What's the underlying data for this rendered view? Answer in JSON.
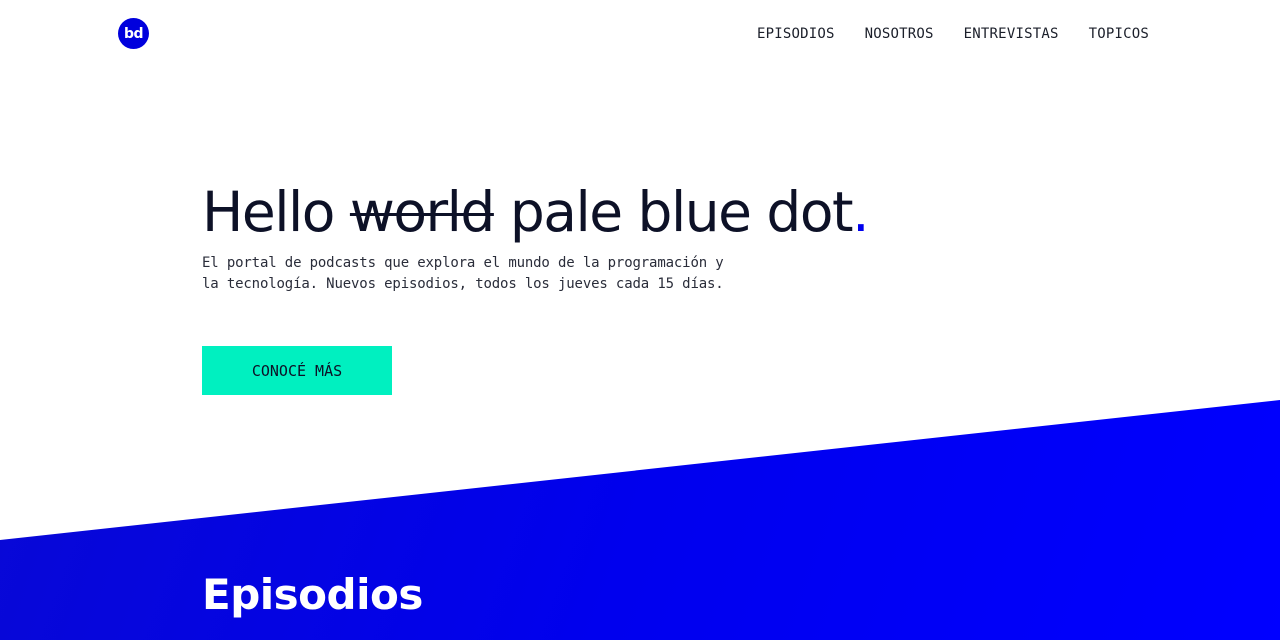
{
  "brand": {
    "logo_text": "bd"
  },
  "nav": {
    "items": [
      {
        "label": "EPISODIOS"
      },
      {
        "label": "NOSOTROS"
      },
      {
        "label": "ENTREVISTAS"
      },
      {
        "label": "TOPICOS"
      }
    ]
  },
  "hero": {
    "title_start": "Hello",
    "title_struck": "world",
    "title_end": "pale blue dot",
    "title_dot": ".",
    "subtitle": "El portal de podcasts que explora el mundo de la programación y la tecnología. Nuevos episodios, todos los jueves cada 15 días.",
    "cta_label": "CONOCÉ MÁS"
  },
  "episodes": {
    "title": "Episodios"
  },
  "colors": {
    "accent_blue": "#0000ee",
    "cta_teal": "#00f0c0",
    "text_dark": "#0d1127"
  }
}
